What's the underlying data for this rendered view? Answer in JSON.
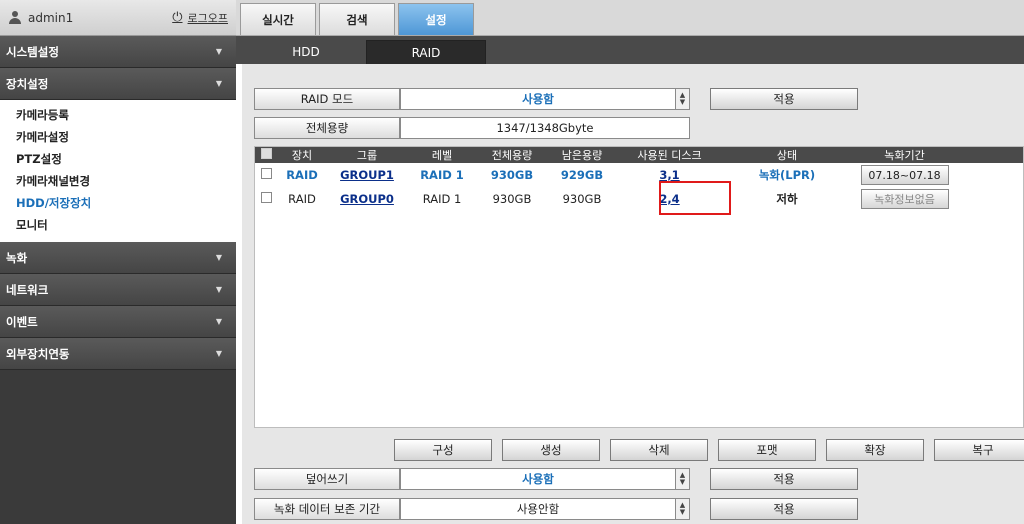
{
  "user": {
    "name": "admin1",
    "logout_label": "로그오프"
  },
  "sidebar": {
    "menus": [
      {
        "label": "시스템설정"
      },
      {
        "label": "장치설정",
        "items": [
          "카메라등록",
          "카메라설정",
          "PTZ설정",
          "카메라채널변경",
          "HDD/저장장치",
          "모니터"
        ],
        "active": 4
      },
      {
        "label": "녹화"
      },
      {
        "label": "네트워크"
      },
      {
        "label": "이벤트"
      },
      {
        "label": "외부장치연동"
      }
    ]
  },
  "top_tabs": [
    "실시간",
    "검색",
    "설정"
  ],
  "sub_tabs": [
    "HDD",
    "RAID"
  ],
  "raid_mode": {
    "label": "RAID 모드",
    "value": "사용함",
    "apply": "적용"
  },
  "capacity": {
    "label": "전체용량",
    "value": "1347/1348Gbyte"
  },
  "table": {
    "headers": [
      "장치",
      "그룹",
      "레벨",
      "전체용량",
      "남은용량",
      "사용된 디스크",
      "상태",
      "녹화기간"
    ],
    "rows": [
      {
        "device": "RAID",
        "group": "GROUP1",
        "level": "RAID 1",
        "total": "930GB",
        "free": "929GB",
        "disks": "3,1",
        "status": "녹화(LPR)",
        "period": "07.18~07.18"
      },
      {
        "device": "RAID",
        "group": "GROUP0",
        "level": "RAID 1",
        "total": "930GB",
        "free": "930GB",
        "disks": "2,4",
        "status": "저하",
        "period": "녹화정보없음"
      }
    ]
  },
  "actions": [
    "구성",
    "생성",
    "삭제",
    "포맷",
    "확장",
    "복구"
  ],
  "overwrite": {
    "label": "덮어쓰기",
    "value": "사용함",
    "apply": "적용"
  },
  "retention": {
    "label": "녹화 데이터 보존 기간",
    "value": "사용안함",
    "apply": "적용"
  },
  "colors": {
    "accent": "#4e97d6",
    "highlight": "#e01a1a"
  }
}
